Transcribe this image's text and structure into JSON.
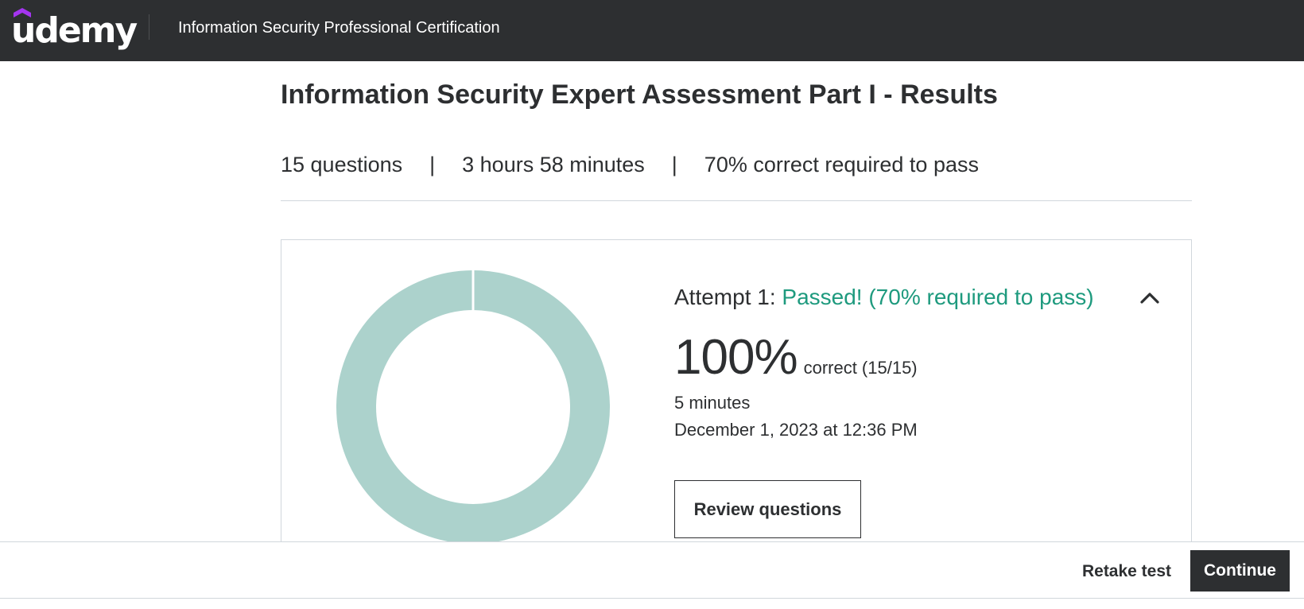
{
  "header": {
    "logo_text": "udemy",
    "course_title": "Information Security Professional Certification"
  },
  "assessment": {
    "title": "Information Security Expert Assessment Part I - Results",
    "questions": "15 questions",
    "duration_limit": "3 hours 58 minutes",
    "pass_requirement": "70% correct required to pass",
    "separator": "|"
  },
  "attempt": {
    "label": "Attempt 1:",
    "status": "Passed! (70% required to pass)",
    "score_percent": "100%",
    "score_detail": "correct (15/15)",
    "score_fraction": 1.0,
    "time_taken": "5 minutes",
    "date": "December 1, 2023 at 12:36 PM",
    "review_label": "Review questions"
  },
  "footer": {
    "retake_label": "Retake test",
    "continue_label": "Continue"
  },
  "colors": {
    "header_bg": "#2d2f31",
    "logo_accent": "#a435f0",
    "pass_green": "#1e9a7e",
    "donut_fill": "#acd2cc"
  },
  "icons": {
    "collapse": "chevron-up-icon",
    "logo_hat": "graduation-hat-icon"
  }
}
